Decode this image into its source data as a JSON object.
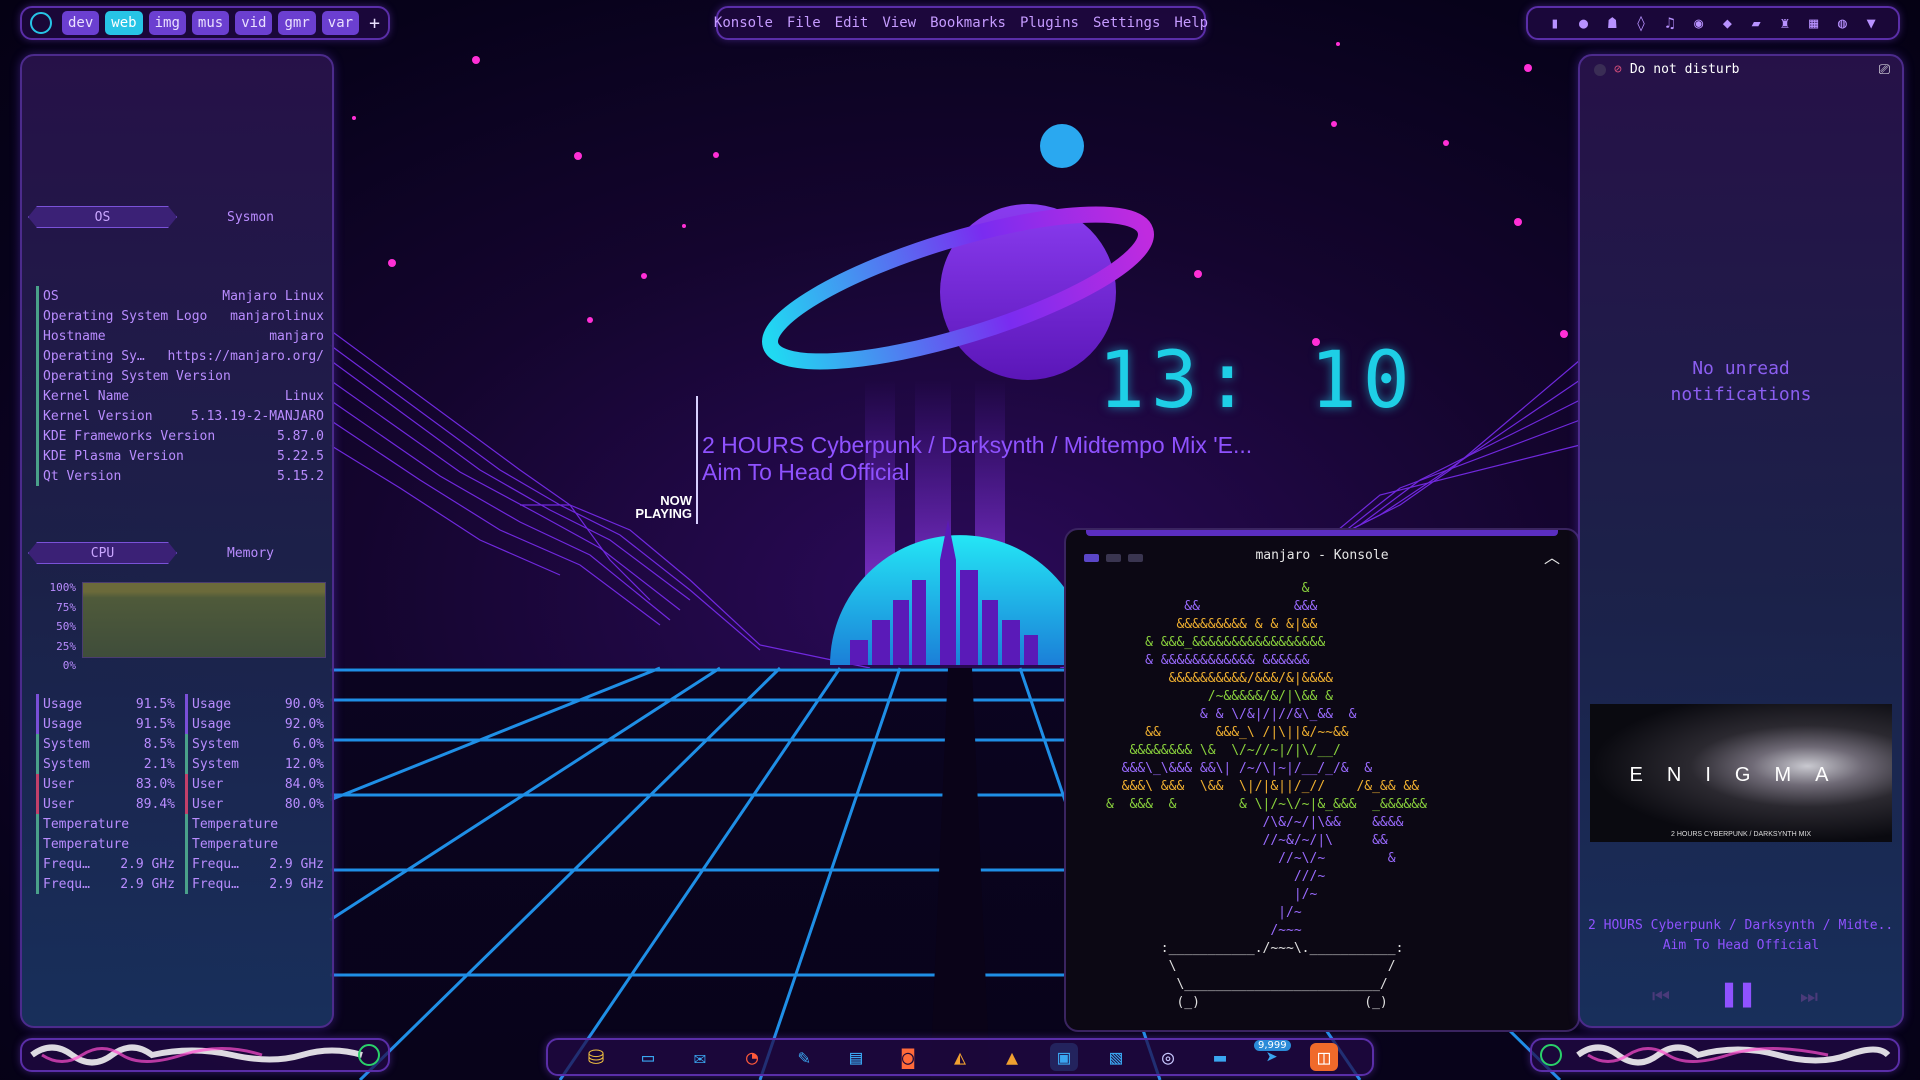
{
  "workspaces": [
    "dev",
    "web",
    "img",
    "mus",
    "vid",
    "gmr",
    "var"
  ],
  "active_workspace": "web",
  "add_workspace": "+",
  "menu": [
    "Konsole",
    "File",
    "Edit",
    "View",
    "Bookmarks",
    "Plugins",
    "Settings",
    "Help"
  ],
  "sysmon": {
    "tab_os": "OS",
    "tab_sysmon": "Sysmon",
    "os_rows": [
      {
        "k": "OS",
        "v": "Manjaro Linux"
      },
      {
        "k": "Operating System Logo",
        "v": "manjarolinux"
      },
      {
        "k": "Hostname",
        "v": "manjaro"
      },
      {
        "k": "Operating Sy…",
        "v": "https://manjaro.org/"
      },
      {
        "k": "Operating System Version",
        "v": ""
      },
      {
        "k": "Kernel Name",
        "v": "Linux"
      },
      {
        "k": "Kernel Version",
        "v": "5.13.19-2-MANJARO"
      },
      {
        "k": "KDE Frameworks Version",
        "v": "5.87.0"
      },
      {
        "k": "KDE Plasma Version",
        "v": "5.22.5"
      },
      {
        "k": "Qt Version",
        "v": "5.15.2"
      }
    ],
    "tab_cpu": "CPU",
    "tab_memory": "Memory",
    "graph_ticks": [
      "100%",
      "75%",
      "50%",
      "25%",
      "0%"
    ],
    "cpu_left": [
      {
        "k": "Usage",
        "v": "91.5%"
      },
      {
        "k": "Usage",
        "v": "91.5%"
      },
      {
        "k": "System",
        "v": "8.5%"
      },
      {
        "k": "System",
        "v": "2.1%"
      },
      {
        "k": "User",
        "v": "83.0%"
      },
      {
        "k": "User",
        "v": "89.4%"
      },
      {
        "k": "Temperature",
        "v": ""
      },
      {
        "k": "Temperature",
        "v": ""
      },
      {
        "k": "Frequ…",
        "v": "2.9 GHz"
      },
      {
        "k": "Frequ…",
        "v": "2.9 GHz"
      }
    ],
    "cpu_right": [
      {
        "k": "Usage",
        "v": "90.0%"
      },
      {
        "k": "Usage",
        "v": "92.0%"
      },
      {
        "k": "System",
        "v": "6.0%"
      },
      {
        "k": "System",
        "v": "12.0%"
      },
      {
        "k": "User",
        "v": "84.0%"
      },
      {
        "k": "User",
        "v": "80.0%"
      },
      {
        "k": "Temperature",
        "v": ""
      },
      {
        "k": "Temperature",
        "v": ""
      },
      {
        "k": "Frequ…",
        "v": "2.9 GHz"
      },
      {
        "k": "Frequ…",
        "v": "2.9 GHz"
      }
    ]
  },
  "clock": "13: 10",
  "now_playing": {
    "label_1": "NOW",
    "label_2": "PLAYING",
    "title": "2 HOURS Cyberpunk / Darksynth / Midtempo Mix 'E...",
    "artist": "Aim To Head Official"
  },
  "konsole": {
    "title": "manjaro - Konsole",
    "art_lines": [
      "                         &",
      "          &&            &&&",
      "         &&&&&&&&& & & &|&&",
      "     & &&&_&&&&&&&&&&&&&&&&&",
      "     & &&&&&&&&&&&& &&&&&&",
      "        &&&&&&&&&&/&&&/&|&&&&",
      "             /~&&&&&/&/|\\&& &",
      "            & & \\/&|/|//&\\_&&  &",
      "     &&       &&&_\\ /|\\||&/~~&&",
      "   &&&&&&&& \\&  \\/~//~|/|\\/__/",
      "  &&&\\_\\&&& &&\\| /~/\\|~|/__/_/&  &",
      "  &&&\\ &&&  \\&&  \\|/|&||/_//    /&_&& &&",
      "&  &&&  &        & \\|/~\\/~|&_&&&  _&&&&&&",
      "                    /\\&/~/|\\&&    &&&&",
      "                    //~&/~/|\\     &&",
      "                      //~\\/~        &",
      "                        ///~",
      "                        |/~",
      "                      |/~",
      "                     /~~~",
      "       :___________./~~~\\.___________:",
      "        \\                           /",
      "         \\_________________________/",
      "         (_)                     (_)"
    ]
  },
  "notifications": {
    "dnd_label": "Do not disturb",
    "empty_line_1": "No unread",
    "empty_line_2": "notifications",
    "album_word": "ENIGMA",
    "album_caption": "2 HOURS CYBERPUNK / DARKSYNTH MIX",
    "track_title": "2 HOURS Cyberpunk / Darksynth / Midte...",
    "track_artist": "Aim To Head Official"
  },
  "dock_badge": "9,999",
  "colors": {
    "accent": "#8f52ff",
    "cyan": "#1ecfe6",
    "panel_border": "#4c2b8c"
  }
}
